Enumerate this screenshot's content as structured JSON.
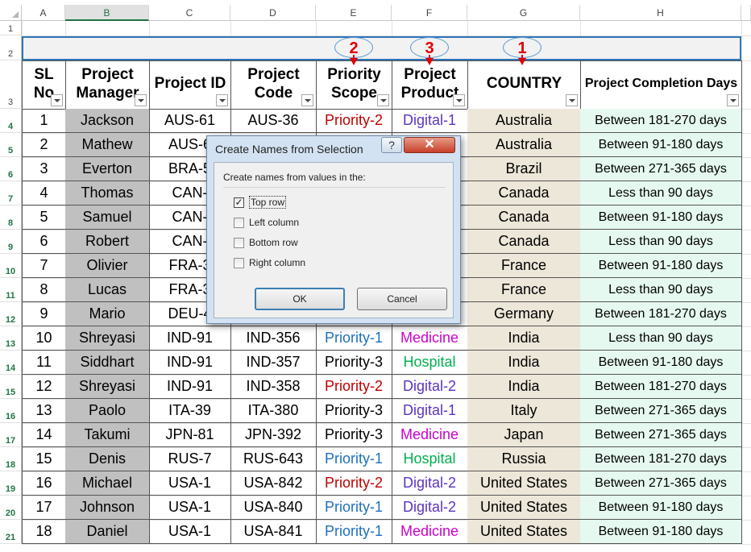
{
  "column_headers": [
    "A",
    "B",
    "C",
    "D",
    "E",
    "F",
    "G",
    "H"
  ],
  "selected_column": "B",
  "row_numbers": [
    "1",
    "2",
    "3",
    "4",
    "5",
    "6",
    "7",
    "8",
    "9",
    "10",
    "11",
    "12",
    "13",
    "14",
    "15",
    "16",
    "17",
    "18",
    "19",
    "20",
    "21"
  ],
  "table_headers": {
    "sl_no": "SL No",
    "project_manager": "Project Manager",
    "project_id": "Project ID",
    "project_code": "Project Code",
    "priority_scope": "Priority Scope",
    "project_product": "Project Product",
    "country": "COUNTRY",
    "completion_days": "Project Completion Days"
  },
  "annotations": [
    {
      "label": "2",
      "column": "E"
    },
    {
      "label": "3",
      "column": "F"
    },
    {
      "label": "1",
      "column": "G"
    }
  ],
  "colors": {
    "priority_1": "#1f6fbf",
    "priority_2": "#c00000",
    "priority_3": "#000000",
    "digital": "#5b33c6",
    "medicine": "#cc00cc",
    "hospital": "#00b050",
    "selection_green": "#217346",
    "annotation_red": "#e00000"
  },
  "rows": [
    {
      "sl": "1",
      "manager": "Jackson",
      "id": "AUS-61",
      "code": "AUS-36",
      "priority": "Priority-2",
      "product": "Digital-1",
      "country": "Australia",
      "days": "Between 181-270 days"
    },
    {
      "sl": "2",
      "manager": "Mathew",
      "id": "AUS-6",
      "code": "",
      "priority": "",
      "product": "",
      "country": "Australia",
      "days": "Between 91-180 days"
    },
    {
      "sl": "3",
      "manager": "Everton",
      "id": "BRA-5",
      "code": "",
      "priority": "",
      "product": "",
      "country": "Brazil",
      "days": "Between 271-365 days"
    },
    {
      "sl": "4",
      "manager": "Thomas",
      "id": "CAN-",
      "code": "",
      "priority": "",
      "product": "",
      "country": "Canada",
      "days": "Less than 90 days"
    },
    {
      "sl": "5",
      "manager": "Samuel",
      "id": "CAN-",
      "code": "",
      "priority": "",
      "product": "",
      "country": "Canada",
      "days": "Between 91-180 days"
    },
    {
      "sl": "6",
      "manager": "Robert",
      "id": "CAN-",
      "code": "",
      "priority": "",
      "product": "",
      "country": "Canada",
      "days": "Less than 90 days"
    },
    {
      "sl": "7",
      "manager": "Olivier",
      "id": "FRA-3",
      "code": "",
      "priority": "",
      "product": "",
      "country": "France",
      "days": "Between 91-180 days"
    },
    {
      "sl": "8",
      "manager": "Lucas",
      "id": "FRA-3",
      "code": "",
      "priority": "",
      "product": "",
      "country": "France",
      "days": "Less than 90 days"
    },
    {
      "sl": "9",
      "manager": "Mario",
      "id": "DEU-4",
      "code": "",
      "priority": "",
      "product": "",
      "country": "Germany",
      "days": "Between 181-270 days"
    },
    {
      "sl": "10",
      "manager": "Shreyasi",
      "id": "IND-91",
      "code": "IND-356",
      "priority": "Priority-1",
      "product": "Medicine",
      "country": "India",
      "days": "Less than 90 days"
    },
    {
      "sl": "11",
      "manager": "Siddhart",
      "id": "IND-91",
      "code": "IND-357",
      "priority": "Priority-3",
      "product": "Hospital",
      "country": "India",
      "days": "Between 91-180 days"
    },
    {
      "sl": "12",
      "manager": "Shreyasi",
      "id": "IND-91",
      "code": "IND-358",
      "priority": "Priority-2",
      "product": "Digital-2",
      "country": "India",
      "days": "Between 181-270 days"
    },
    {
      "sl": "13",
      "manager": "Paolo",
      "id": "ITA-39",
      "code": "ITA-380",
      "priority": "Priority-3",
      "product": "Digital-1",
      "country": "Italy",
      "days": "Between 271-365 days"
    },
    {
      "sl": "14",
      "manager": "Takumi",
      "id": "JPN-81",
      "code": "JPN-392",
      "priority": "Priority-3",
      "product": "Medicine",
      "country": "Japan",
      "days": "Between 271-365 days"
    },
    {
      "sl": "15",
      "manager": "Denis",
      "id": "RUS-7",
      "code": "RUS-643",
      "priority": "Priority-1",
      "product": "Hospital",
      "country": "Russia",
      "days": "Between 181-270 days"
    },
    {
      "sl": "16",
      "manager": "Michael",
      "id": "USA-1",
      "code": "USA-842",
      "priority": "Priority-2",
      "product": "Digital-2",
      "country": "United States",
      "days": "Between 271-365 days"
    },
    {
      "sl": "17",
      "manager": "Johnson",
      "id": "USA-1",
      "code": "USA-840",
      "priority": "Priority-1",
      "product": "Digital-2",
      "country": "United States",
      "days": "Between 91-180 days"
    },
    {
      "sl": "18",
      "manager": "Daniel",
      "id": "USA-1",
      "code": "USA-841",
      "priority": "Priority-1",
      "product": "Medicine",
      "country": "United States",
      "days": "Between 91-180 days"
    }
  ],
  "dialog": {
    "title": "Create Names from Selection",
    "help_label": "?",
    "close_label": "✕",
    "caption": "Create names from values in the:",
    "options": [
      {
        "label": "Top row",
        "checked": true
      },
      {
        "label": "Left column",
        "checked": false
      },
      {
        "label": "Bottom row",
        "checked": false
      },
      {
        "label": "Right column",
        "checked": false
      }
    ],
    "ok_label": "OK",
    "cancel_label": "Cancel"
  }
}
